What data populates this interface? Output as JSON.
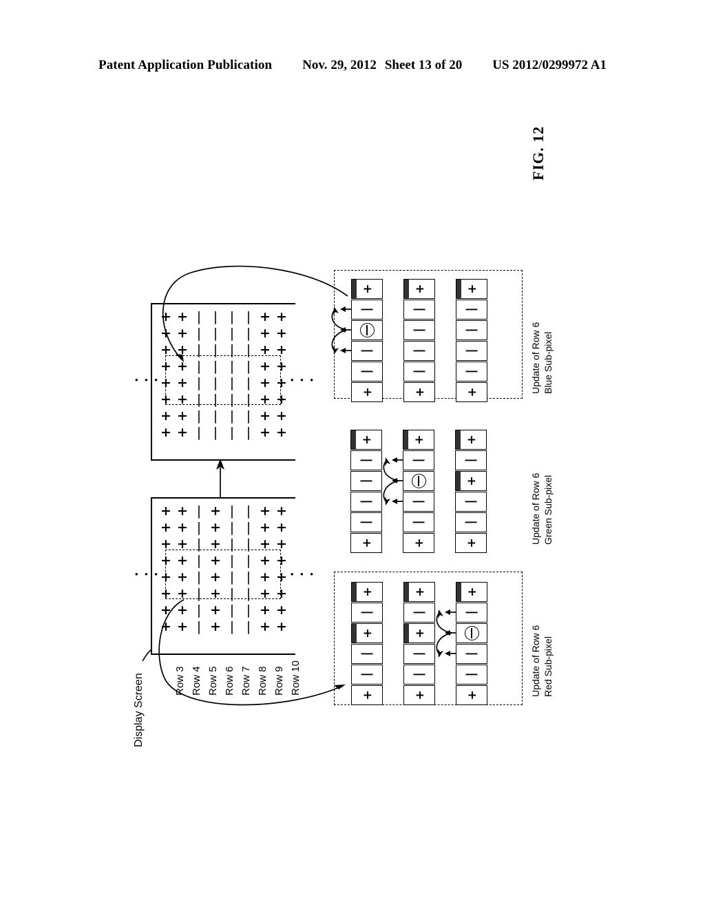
{
  "header": {
    "publication": "Patent Application Publication",
    "date": "Nov. 29, 2012",
    "sheet": "Sheet 13 of 20",
    "patent_number": "US 2012/0299972 A1"
  },
  "figure": {
    "label": "FIG. 12",
    "screen_label": "Display Screen"
  },
  "screens": {
    "before": {
      "columns": 8,
      "rows": 8,
      "pattern": [
        "+",
        "+",
        "|",
        "+",
        "|",
        "|",
        "+",
        "+"
      ],
      "row_labels": [
        "Row 3",
        "Row 4",
        "Row 5",
        "Row 6",
        "Row 7",
        "Row 8",
        "Row 9",
        "Row 10"
      ],
      "ellipsis": "• • •"
    },
    "after": {
      "columns": 8,
      "rows": 8,
      "pattern": [
        "+",
        "+",
        "|",
        "|",
        "|",
        "|",
        "+",
        "+"
      ],
      "ellipsis": "• • •"
    }
  },
  "panels": [
    {
      "id": "red",
      "title_line1": "Update of Row 6",
      "title_line2": "Red Sub-pixel",
      "boxed": true,
      "active_strip": 2,
      "strips": [
        {
          "cells": [
            "+",
            "|",
            "+",
            "|",
            "|",
            "+"
          ],
          "bars": [
            true,
            false,
            true,
            false,
            false,
            false
          ]
        },
        {
          "cells": [
            "+",
            "|",
            "+",
            "|",
            "|",
            "+"
          ],
          "bars": [
            true,
            false,
            true,
            false,
            false,
            false
          ]
        },
        {
          "cells": [
            "+",
            "|",
            "O",
            "|",
            "|",
            "+"
          ],
          "bars": [
            true,
            false,
            false,
            false,
            false,
            false
          ]
        }
      ]
    },
    {
      "id": "green",
      "title_line1": "Update of Row 6",
      "title_line2": "Green Sub-pixel",
      "boxed": false,
      "active_strip": 1,
      "strips": [
        {
          "cells": [
            "+",
            "|",
            "|",
            "|",
            "|",
            "+"
          ],
          "bars": [
            true,
            false,
            false,
            false,
            false,
            false
          ]
        },
        {
          "cells": [
            "+",
            "|",
            "O",
            "|",
            "|",
            "+"
          ],
          "bars": [
            true,
            false,
            false,
            false,
            false,
            false
          ]
        },
        {
          "cells": [
            "+",
            "|",
            "+",
            "|",
            "|",
            "+"
          ],
          "bars": [
            true,
            false,
            true,
            false,
            false,
            false
          ]
        }
      ]
    },
    {
      "id": "blue",
      "title_line1": "Update of Row 6",
      "title_line2": "Blue Sub-pixel",
      "boxed": true,
      "active_strip": 0,
      "strips": [
        {
          "cells": [
            "+",
            "|",
            "O",
            "|",
            "|",
            "+"
          ],
          "bars": [
            true,
            false,
            false,
            false,
            false,
            false
          ]
        },
        {
          "cells": [
            "+",
            "|",
            "|",
            "|",
            "|",
            "+"
          ],
          "bars": [
            true,
            false,
            false,
            false,
            false,
            false
          ]
        },
        {
          "cells": [
            "+",
            "|",
            "|",
            "|",
            "|",
            "+"
          ],
          "bars": [
            true,
            false,
            false,
            false,
            false,
            false
          ]
        }
      ]
    }
  ],
  "colors": {
    "ink": "#000000",
    "bar": "#333333",
    "paper": "#ffffff"
  }
}
